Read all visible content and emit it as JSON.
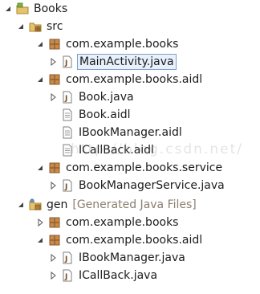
{
  "tree": {
    "project": {
      "label": "Books"
    },
    "src": {
      "label": "src"
    },
    "pkg_books": {
      "label": "com.example.books"
    },
    "main_activity": {
      "label": "MainActivity.java"
    },
    "pkg_aidl": {
      "label": "com.example.books.aidl"
    },
    "book_java": {
      "label": "Book.java"
    },
    "book_aidl": {
      "label": "Book.aidl"
    },
    "ibookmanager_aidl": {
      "label": "IBookManager.aidl"
    },
    "icallback_aidl": {
      "label": "ICallBack.aidl"
    },
    "pkg_service": {
      "label": "com.example.books.service"
    },
    "bookmanagerservice": {
      "label": "BookManagerService.java"
    },
    "gen": {
      "label": "gen",
      "decoration": "[Generated Java Files]"
    },
    "gen_pkg_books": {
      "label": "com.example.books"
    },
    "gen_pkg_aidl": {
      "label": "com.example.books.aidl"
    },
    "gen_ibookmanager": {
      "label": "IBookManager.java"
    },
    "gen_icallback": {
      "label": "ICallBack.java"
    }
  },
  "watermark": "http://blog.csdn.net/",
  "colors": {
    "selection_border": "#7da2ce",
    "selection_fill": "#e8f1fb",
    "package_brown": "#8a5a2b",
    "decoration_text": "#8a7f6e"
  }
}
